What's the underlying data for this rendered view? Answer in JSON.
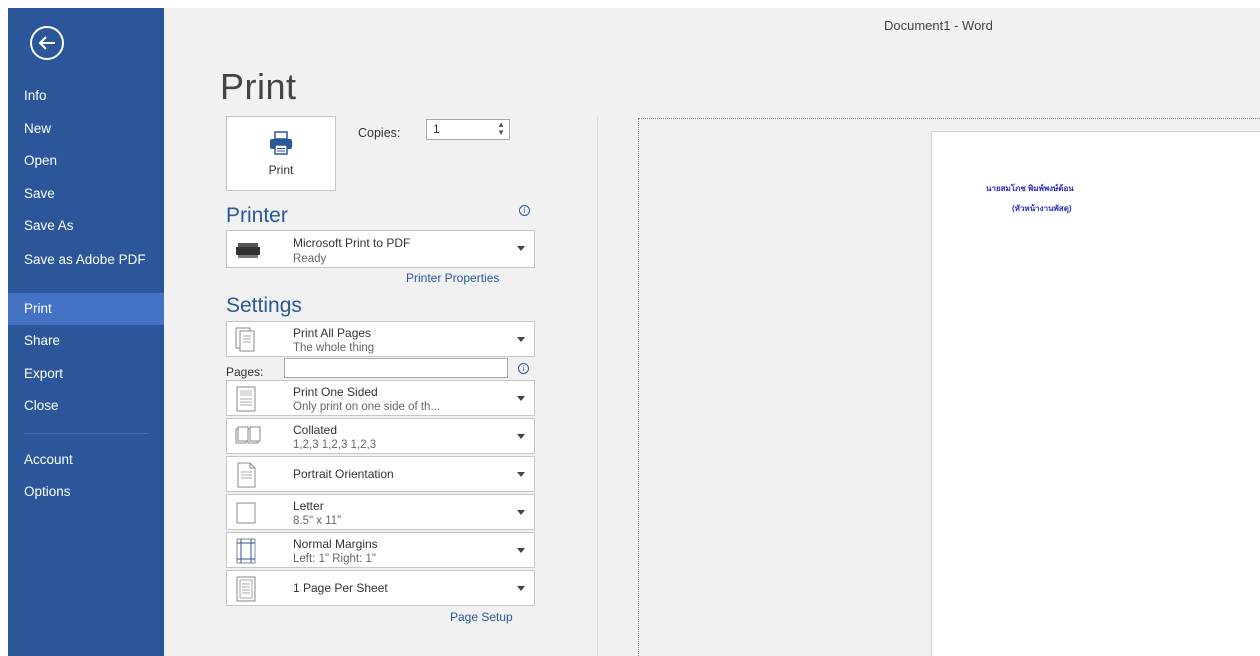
{
  "window": {
    "title": "Document1 - Word"
  },
  "nav": {
    "back": "back-arrow-icon",
    "items": [
      {
        "label": "Info"
      },
      {
        "label": "New"
      },
      {
        "label": "Open"
      },
      {
        "label": "Save"
      },
      {
        "label": "Save As"
      },
      {
        "label": "Save as Adobe PDF"
      },
      {
        "label": "Print",
        "active": true
      },
      {
        "label": "Share"
      },
      {
        "label": "Export"
      },
      {
        "label": "Close"
      },
      {
        "label": "Account"
      },
      {
        "label": "Options"
      }
    ]
  },
  "print": {
    "title": "Print",
    "button_label": "Print",
    "copies_label": "Copies:",
    "copies_value": "1",
    "printer_header": "Printer",
    "printer": {
      "name": "Microsoft Print to PDF",
      "status": "Ready"
    },
    "printer_properties": "Printer Properties",
    "settings_header": "Settings",
    "pages_label": "Pages:",
    "settings": [
      {
        "t1": "Print All Pages",
        "t2": "The whole thing"
      },
      {
        "t1": "Print One Sided",
        "t2": "Only print on one side of th..."
      },
      {
        "t1": "Collated",
        "t2": "1,2,3   1,2,3   1,2,3"
      },
      {
        "t1": "Portrait Orientation"
      },
      {
        "t1": "Letter",
        "t2": "8.5\" x 11\""
      },
      {
        "t1": "Normal Margins",
        "t2": "Left:  1\"   Right:  1\""
      },
      {
        "t1": "1 Page Per Sheet"
      }
    ],
    "page_setup": "Page Setup"
  },
  "preview": {
    "line1": "นายสมโภช พิมพ์พงษ์ต้อน",
    "line2": "(หัวหน้างานพัสดุ)"
  },
  "colors": {
    "accent": "#2b579a",
    "nav_active": "#4472c4"
  }
}
